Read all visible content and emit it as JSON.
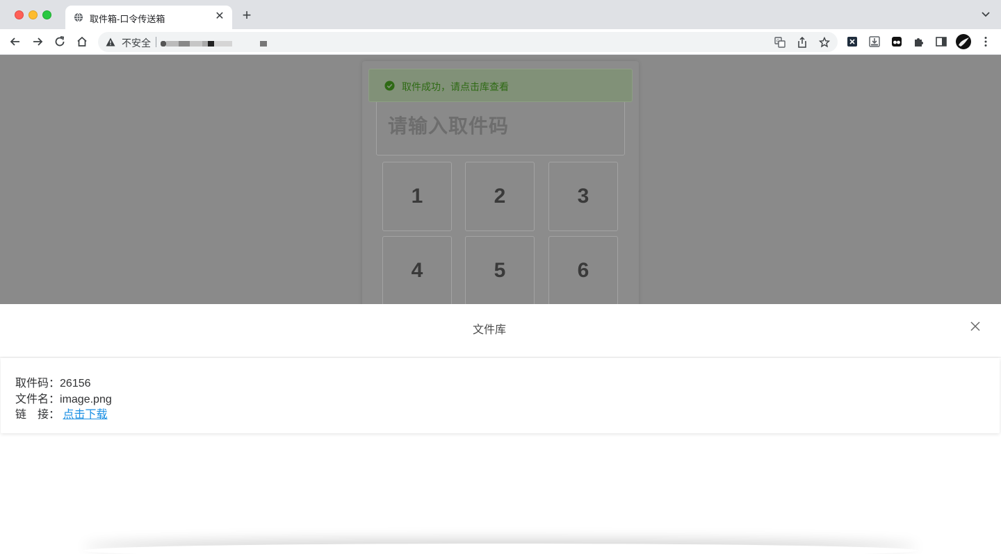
{
  "browser": {
    "tab_title": "取件箱-口令传送箱",
    "tab_close": "✕",
    "new_tab": "+",
    "security_label": "不安全"
  },
  "page": {
    "alert_text": "取件成功，请点击库查看",
    "code_placeholder": "请输入取件码",
    "keys": [
      "1",
      "2",
      "3",
      "4",
      "5",
      "6"
    ]
  },
  "drawer": {
    "title": "文件库",
    "code_label": "取件码：",
    "code_value": "26156",
    "name_label": "文件名：",
    "name_value": "image.png",
    "link_label": "链　接：",
    "link_text": "点击下载"
  },
  "colors": {
    "success": "#52c41a",
    "link": "#1a8fe3",
    "overlay": "#8a8a8a"
  }
}
